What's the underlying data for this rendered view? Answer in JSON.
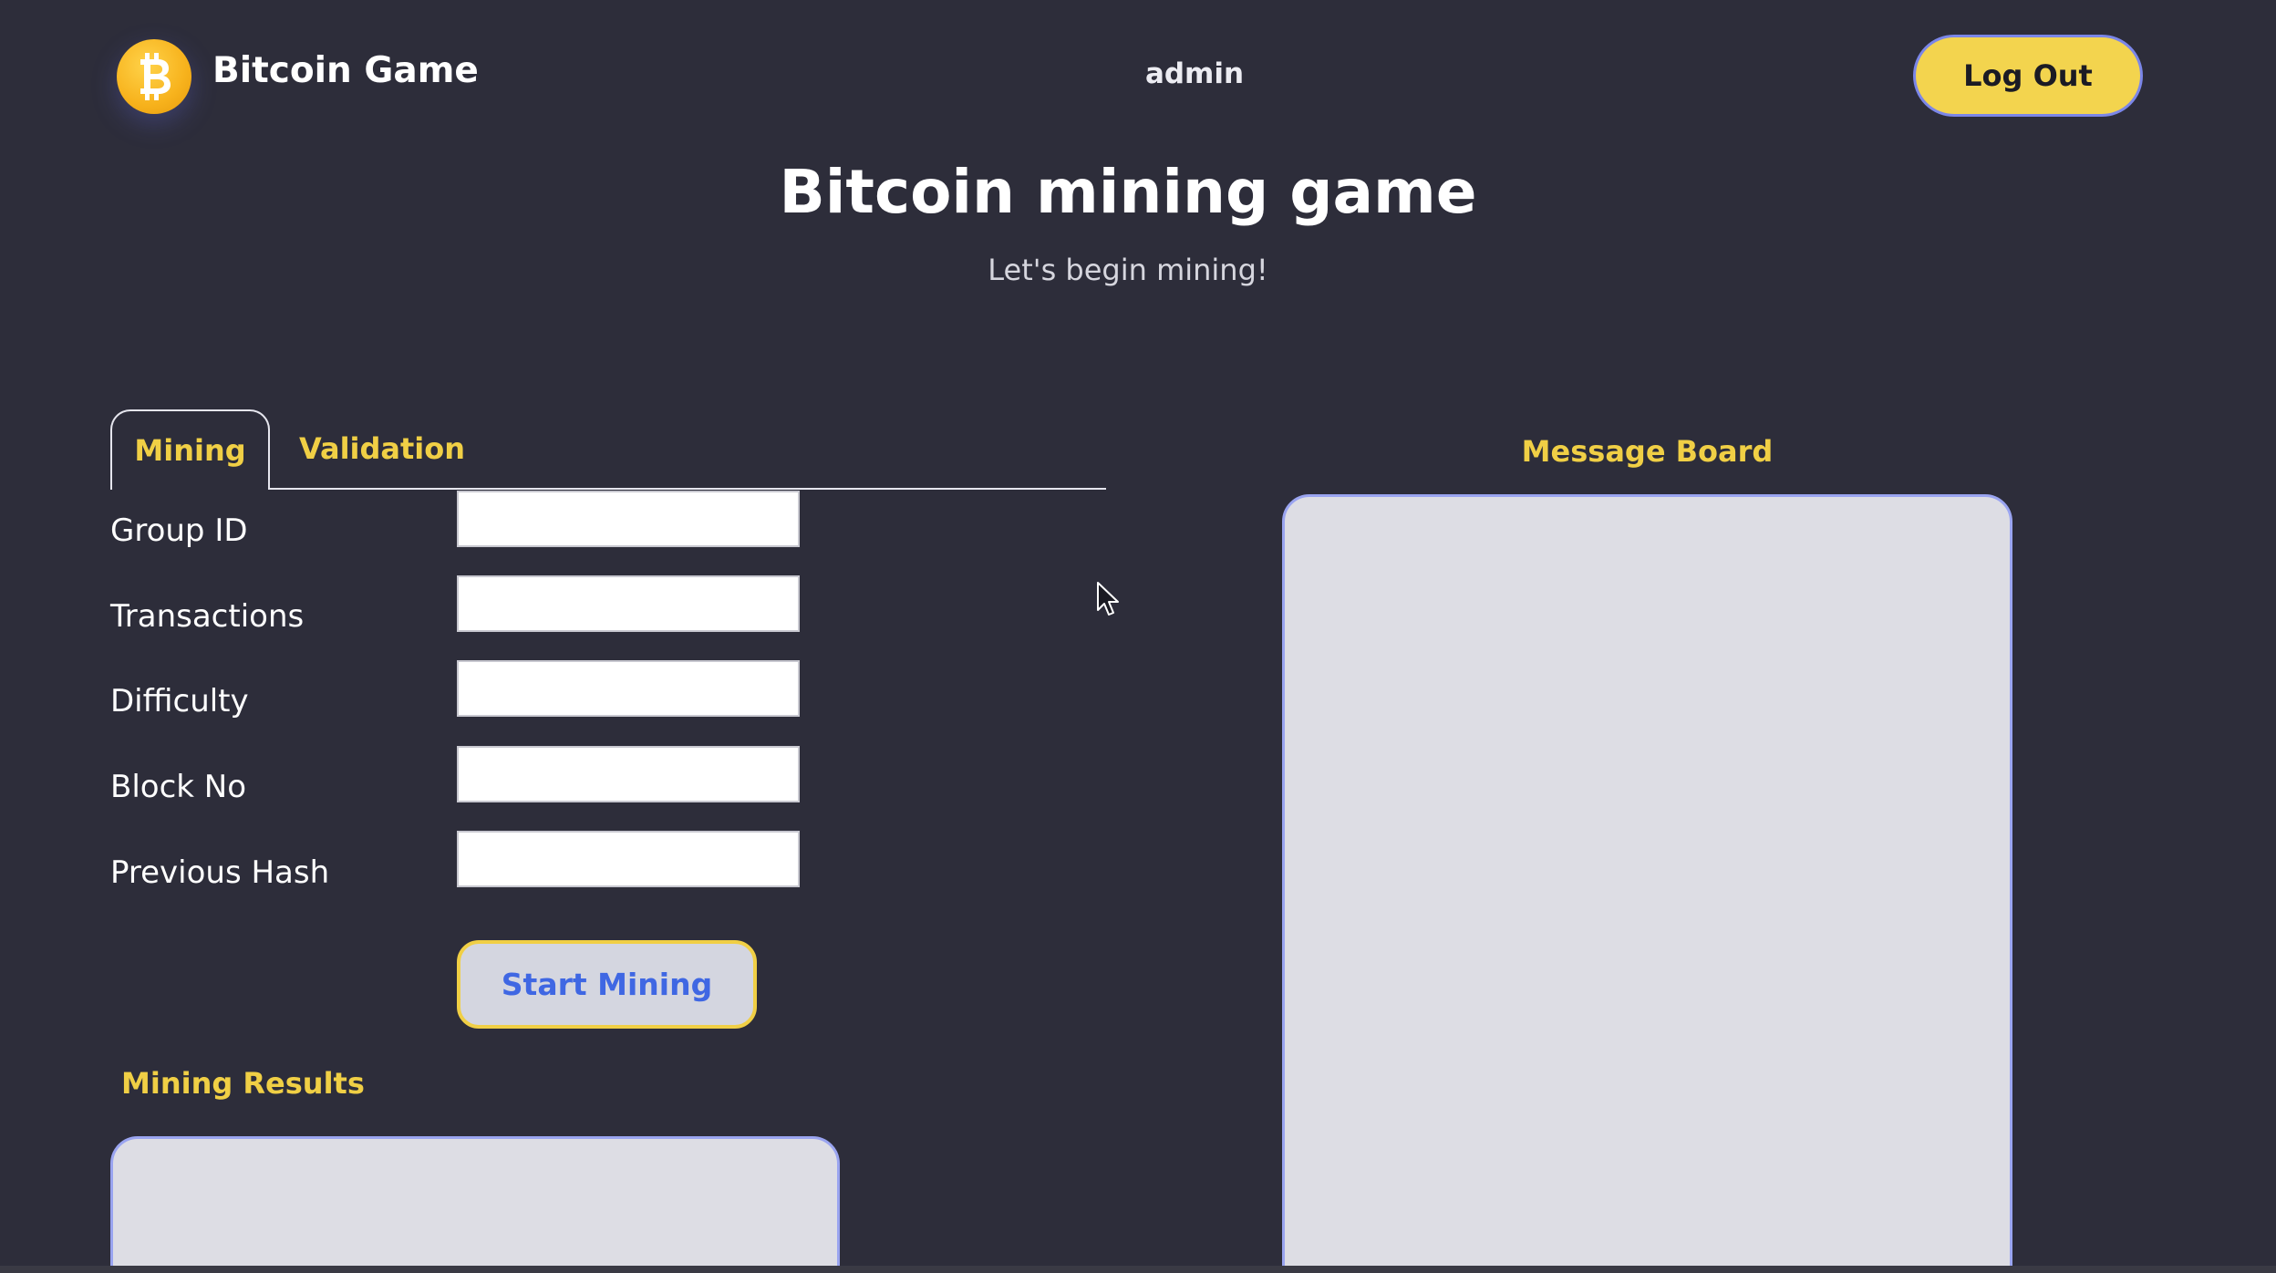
{
  "header": {
    "brand": "Bitcoin Game",
    "logo_icon": "bitcoin-icon",
    "username": "admin",
    "logout_label": "Log Out"
  },
  "hero": {
    "title": "Bitcoin mining game",
    "subtitle": "Let's begin mining!"
  },
  "tabs": [
    {
      "label": "Mining",
      "active": true
    },
    {
      "label": "Validation",
      "active": false
    }
  ],
  "form": {
    "fields": [
      {
        "label": "Group ID",
        "value": "",
        "placeholder": ""
      },
      {
        "label": "Transactions",
        "value": "",
        "placeholder": ""
      },
      {
        "label": "Difficulty",
        "value": "",
        "placeholder": ""
      },
      {
        "label": "Block No",
        "value": "",
        "placeholder": ""
      },
      {
        "label": "Previous Hash",
        "value": "",
        "placeholder": ""
      }
    ],
    "submit_label": "Start Mining"
  },
  "results": {
    "heading": "Mining Results"
  },
  "message_board": {
    "heading": "Message Board"
  },
  "colors": {
    "background": "#2d2d3a",
    "accent": "#f0cf45",
    "button_text": "#3f67e3",
    "panel": "#dddde4",
    "panel_border": "#9aa4f0"
  }
}
